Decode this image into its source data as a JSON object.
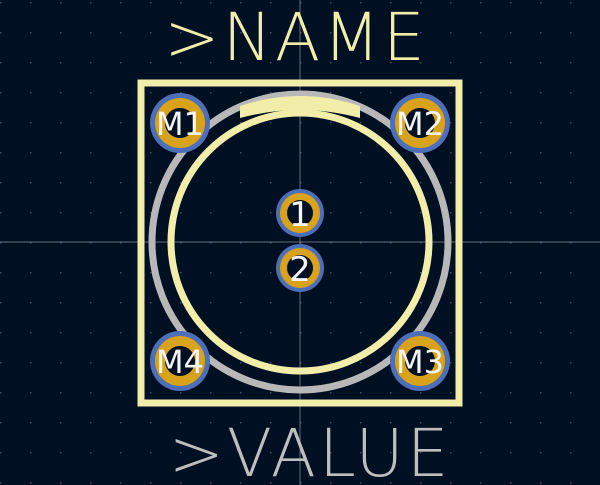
{
  "footprint": {
    "reference": ">NAME",
    "value": ">VALUE"
  },
  "pads": [
    {
      "label": "M1"
    },
    {
      "label": "M2"
    },
    {
      "label": "1"
    },
    {
      "label": "2"
    },
    {
      "label": "M4"
    },
    {
      "label": "M3"
    }
  ],
  "colors": {
    "background": "#001023",
    "grid_dot": "#3a4f6a",
    "crosshair": "#8a93a2",
    "silkscreen": "#f2eeaa",
    "fab_outline": "#b8b8b8",
    "value_text": "#bebebe",
    "pad_copper": "#d8a21a",
    "pad_ring": "#4d6fb8",
    "pad_hole": "#f5f5f5"
  }
}
